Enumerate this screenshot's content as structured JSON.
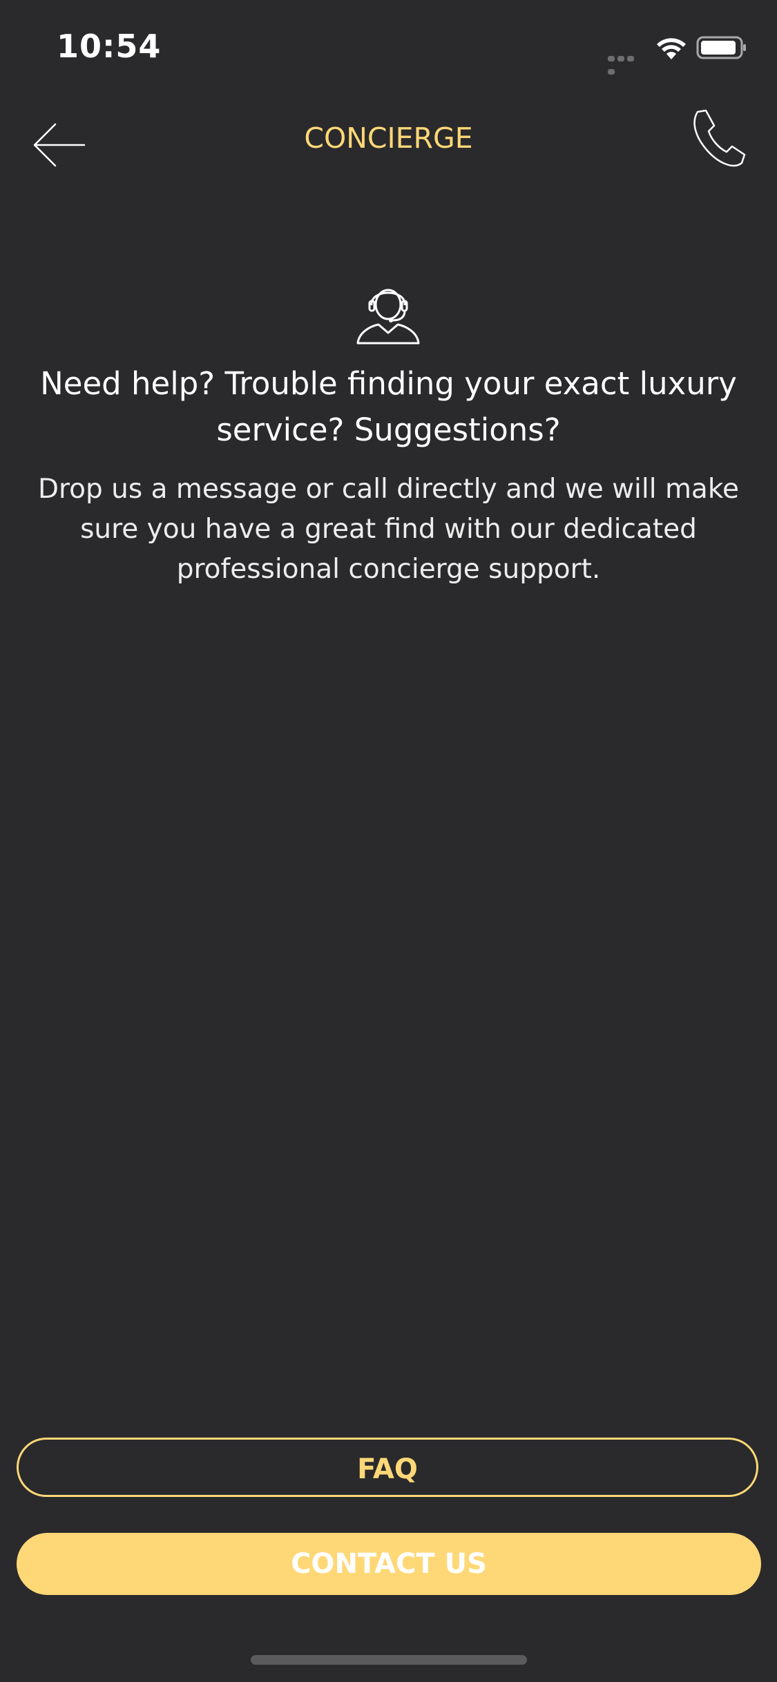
{
  "status_bar": {
    "time": "10:54"
  },
  "nav": {
    "title": "CONCIERGE",
    "back_icon": "arrow-left-icon",
    "call_icon": "phone-icon"
  },
  "content": {
    "icon": "headset-agent-icon",
    "headline": "Need help? Trouble finding your exact luxury service? Suggestions?",
    "description": "Drop us a message or call directly and we will make sure you have a great find with our dedicated professional concierge support."
  },
  "actions": {
    "faq_label": "FAQ",
    "contact_label": "CONTACT US"
  },
  "colors": {
    "background": "#2a2a2c",
    "accent": "#fed877",
    "text": "#ffffff"
  }
}
